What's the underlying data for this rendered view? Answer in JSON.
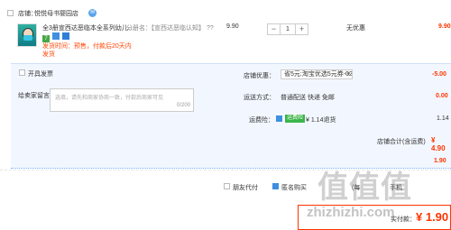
{
  "store": {
    "label": "店铺：",
    "name": "悦悦母书婴园店"
  },
  "product": {
    "title": "全3册宣西达恶临本全系列幼儿…",
    "category_label": "分册名：",
    "category_value": "【宣西达恶临认知】 ??",
    "badges": [
      "7",
      "",
      ""
    ],
    "promo_line": "发货时间：预售，付款后20天内",
    "promo_line2": "发货",
    "unit_price": "9.90",
    "quantity": "1",
    "minus": "−",
    "plus": "+",
    "discount": "无优惠",
    "subtotal": "9.90"
  },
  "options": {
    "invoice_label": "开具发票",
    "message_label": "给卖家留言：",
    "message_placeholder": "选填，请先和商家协商一致，付款后商家可见",
    "message_counter": "0/200",
    "store_discount_label": "店铺优惠：",
    "store_discount_value": "省5元:淘宝优选5元券-02",
    "store_discount_amount": "-5.00",
    "delivery_label": "运送方式：",
    "delivery_value": "普通配送 快递 免邮",
    "delivery_amount": "0.00",
    "insurance_label": "运费险：",
    "insurance_badge": "运费险",
    "insurance_value": "¥ 1.14退货",
    "insurance_amount": "1.14",
    "total_label": "店铺合计(含运费)",
    "total_value": "¥ 4.90"
  },
  "footer": {
    "anonymous_pay": "朋友代付",
    "anonymous_buy": "匿名购买",
    "partial_left": "(每",
    "partial_right": "手机",
    "partial_right2": "…",
    "pay_label": "实付款：",
    "pay_value": "¥ 1.90",
    "top_value": "1.90"
  },
  "watermark": {
    "logo": "值值值",
    "url": "zhizhizhi.com"
  },
  "colors": {
    "accent": "#ff3300",
    "panel_bg": "#f2f7ff",
    "vip": "#5aa4ea",
    "green": "#3bb54a"
  }
}
